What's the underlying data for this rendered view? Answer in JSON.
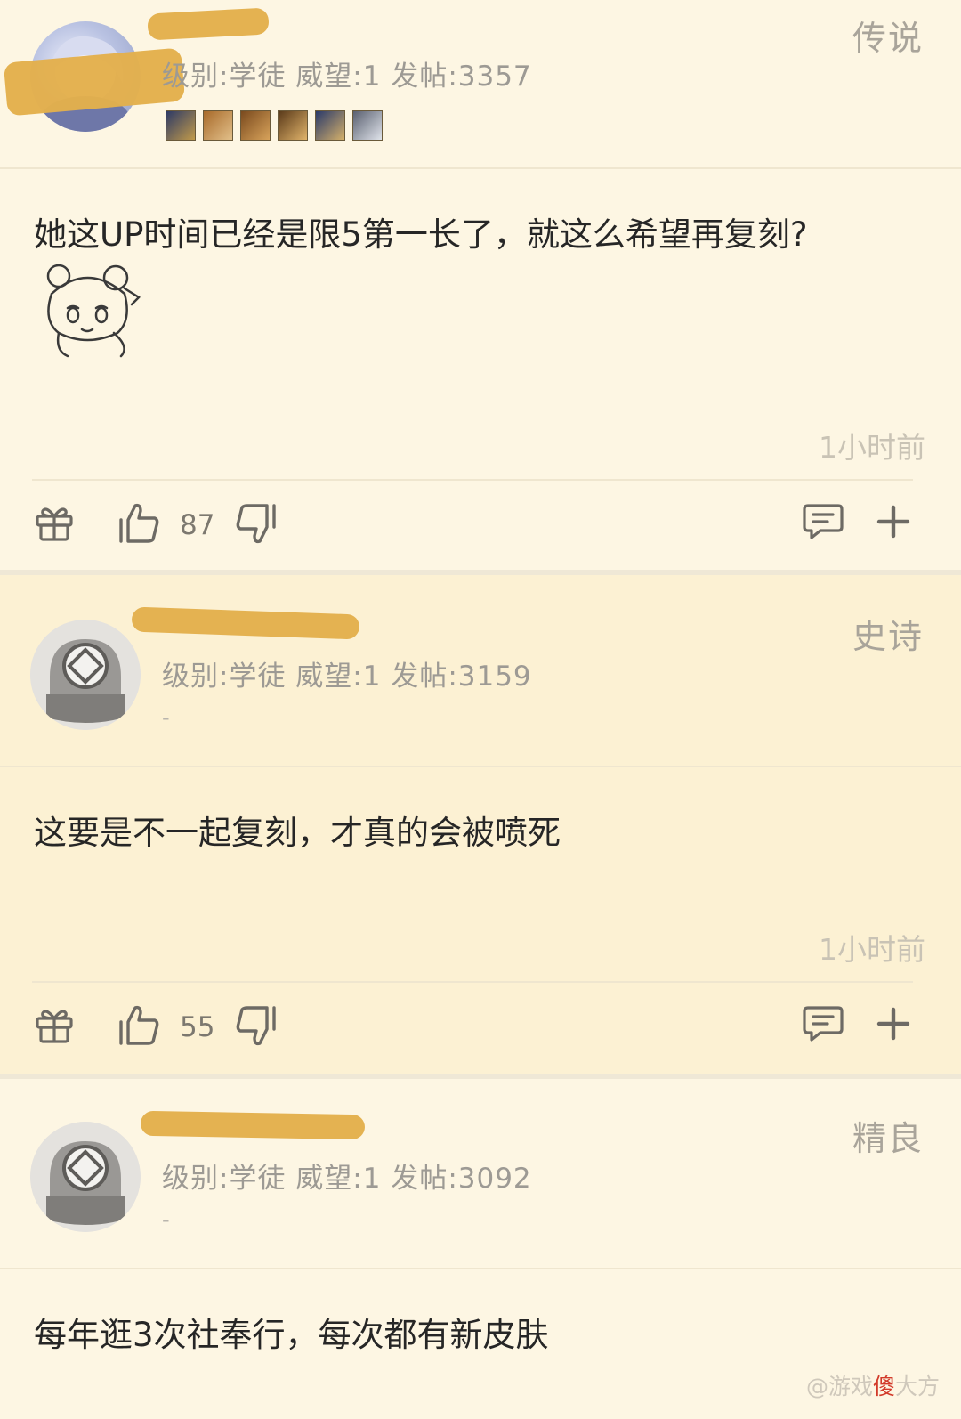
{
  "posts": [
    {
      "username": "",
      "rank": "传说",
      "level_text": "级别:学徒  威望:1  发帖:3357",
      "content": "她这UP时间已经是限5第一长了，就这么希望再复刻?",
      "time": "1小时前",
      "likes": "87",
      "badges": [
        "#3a4c7a",
        "#a86a2a",
        "#b07a3a",
        "#8a5a28",
        "#6a7aa0",
        "#9aa0b0"
      ]
    },
    {
      "username": "",
      "rank": "史诗",
      "level_text": "级别:学徒  威望:1  发帖:3159",
      "dash": "-",
      "content": "这要是不一起复刻，才真的会被喷死",
      "time": "1小时前",
      "likes": "55"
    },
    {
      "username": "",
      "rank": "精良",
      "level_text": "级别:学徒  威望:1  发帖:3092",
      "dash": "-",
      "content": "每年逛3次社奉行，每次都有新皮肤"
    }
  ],
  "watermark": {
    "prefix": "@游戏",
    "highlight": "傻",
    "suffix": "大方"
  },
  "icons": {
    "gift": "gift-icon",
    "like": "thumbs-up-icon",
    "dislike": "thumbs-down-icon",
    "reply": "comment-icon",
    "more": "plus-icon"
  },
  "colors": {
    "background": "#fdf6e3",
    "alt_background": "#fcf1d3",
    "redaction": "#e3b04c",
    "muted_text": "#9d9a94"
  }
}
